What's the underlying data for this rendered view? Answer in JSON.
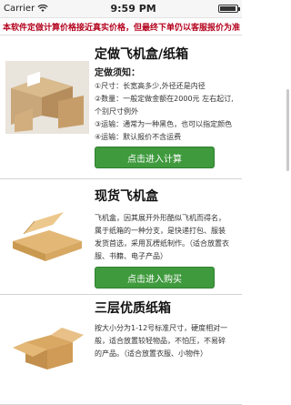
{
  "status_bar": {
    "carrier": "Carrier",
    "time": "9:59 PM"
  },
  "notice": "本软件定做计算价格接近真实价格，但最终下单仍以客服报价为准",
  "products": [
    {
      "title": "定做飞机盒/纸箱",
      "notes_heading": "定做须知：",
      "notes": [
        "①尺寸：长宽高多少,外径还是内径",
        "②数量：一般定做金额在2000元 左右起订,",
        "个别尺寸例外",
        "③运输：通常为一种黑色，也可以指定颜色",
        "④运输：默认报价不含运费"
      ],
      "button": "点击进入计算"
    },
    {
      "title": "现货飞机盒",
      "description": "飞机盒，因其展开外形酷似飞机而得名，属于纸箱的一种分支，是快递打包、服装发货首选，采用瓦楞纸制作。（适合放置衣服、书籍、电子产品）",
      "button": "点击进入购买"
    },
    {
      "title": "三层优质纸箱",
      "description": "按大小分为1-12号标准尺寸，硬度相对一般，适合放置较轻物品，不怕压，不易碎的产品。（适合放置衣服、小物件）"
    }
  ],
  "colors": {
    "accent_green": "#3f9a3d",
    "notice_red": "#b3001b"
  }
}
